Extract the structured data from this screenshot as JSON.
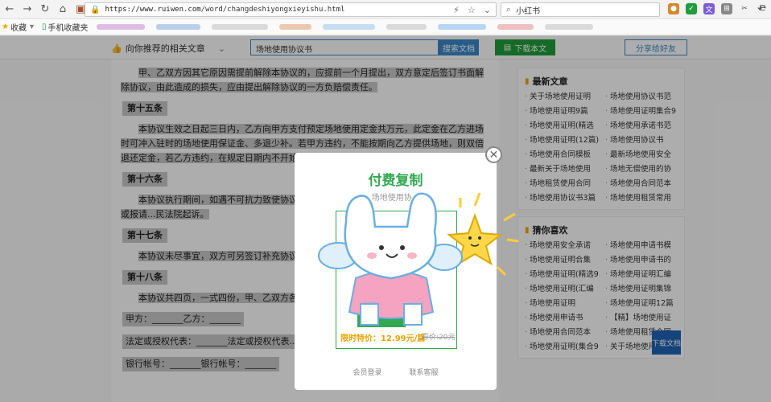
{
  "browser": {
    "url_host": "https://www.ruiwen.com",
    "url_path": "/word/changdeshiyongxieyishu.html",
    "search_query": "小红书",
    "bookmarks": [
      "收藏",
      "手机收藏夹"
    ]
  },
  "toolbar": {
    "recommend_label": "向你推荐的相关文章",
    "search_value": "场地使用协议书",
    "search_button": "搜索文档",
    "download_button": "下载本文",
    "share_button": "分享给好友"
  },
  "article": {
    "p1": "甲、乙双方因其它原因需提前解除本协议的，应提前一个月提出，双方意定后签订书面解除协议，由此造成的损失，应由提出解除协议的一方负赔偿责任。",
    "h15": "第十五条",
    "p2": "本协议生效之日起三日内，乙方向甲方支付预定场地使用定金共万元，此定金在乙方进场时可冲入驻时的场地使用保证金、多退少补。若甲方违约，不能按期向乙方提供场地，则双倍退还定金，若乙方违约，在规定日期内不开始进场装修，则定金作...",
    "h16": "第十六条",
    "p3": "本协议执行期间，如遇不可抗力致使协议无法...议在履行中双方如发生争议，应协商解决或报请...民法院起诉。",
    "h17": "第十七条",
    "p4": "本协议未尽事宜，双方可另签订补充协议。...",
    "h18": "第十八条",
    "p5": "本协议共四页，一式四份，甲、乙双方各持...章之日起生效。",
    "party": "甲方：_______乙方：_______",
    "legal": "法定或授权代表：_______法定或授权代表...",
    "bank": "银行帐号：_______银行帐号：_______"
  },
  "sidebar": {
    "latest_title": "最新文章",
    "latest": [
      "关于场地使用证明",
      "场地使用协议书范",
      "场地使用证明9篇",
      "场地使用证明集合9",
      "场地使用证明(精选",
      "场地使用承诺书范",
      "场地使用证明(12篇)",
      "场地使用协议书",
      "场地使用合同模板",
      "最新场地使用安全",
      "最新关于场地使用",
      "场地无偿使用的协",
      "场地租赁使用合同",
      "场地使用合同范本",
      "场地使用协议书3篇",
      "场地使用租赁常用"
    ],
    "guess_title": "猜你喜欢",
    "guess": [
      "场地使用安全承诺",
      "场地使用申请书模",
      "场地使用证明合集",
      "场地使用申请书的",
      "场地使用证明(精选9",
      "场地使用证明汇编",
      "场地使用证明(汇编",
      "场地使用证明集锦",
      "场地使用证明",
      "场地使用证明12篇",
      "场地使用申请书",
      "【精】场地使用证",
      "场地使用合同范本",
      "场地使用租赁合同",
      "场地使用证明(集合9",
      "关于场地使用证明8"
    ],
    "corner_download": "下载文档"
  },
  "modal": {
    "title": "付费复制",
    "subtitle": "场地使用协...",
    "price": "限时特价：12.99元/篇",
    "old_price": "原价:20元",
    "login": "会员登录",
    "contact": "联系客服"
  },
  "colors": {
    "accent_green": "#33a852",
    "accent_blue": "#3a88c9",
    "price_orange": "#e8a300"
  }
}
